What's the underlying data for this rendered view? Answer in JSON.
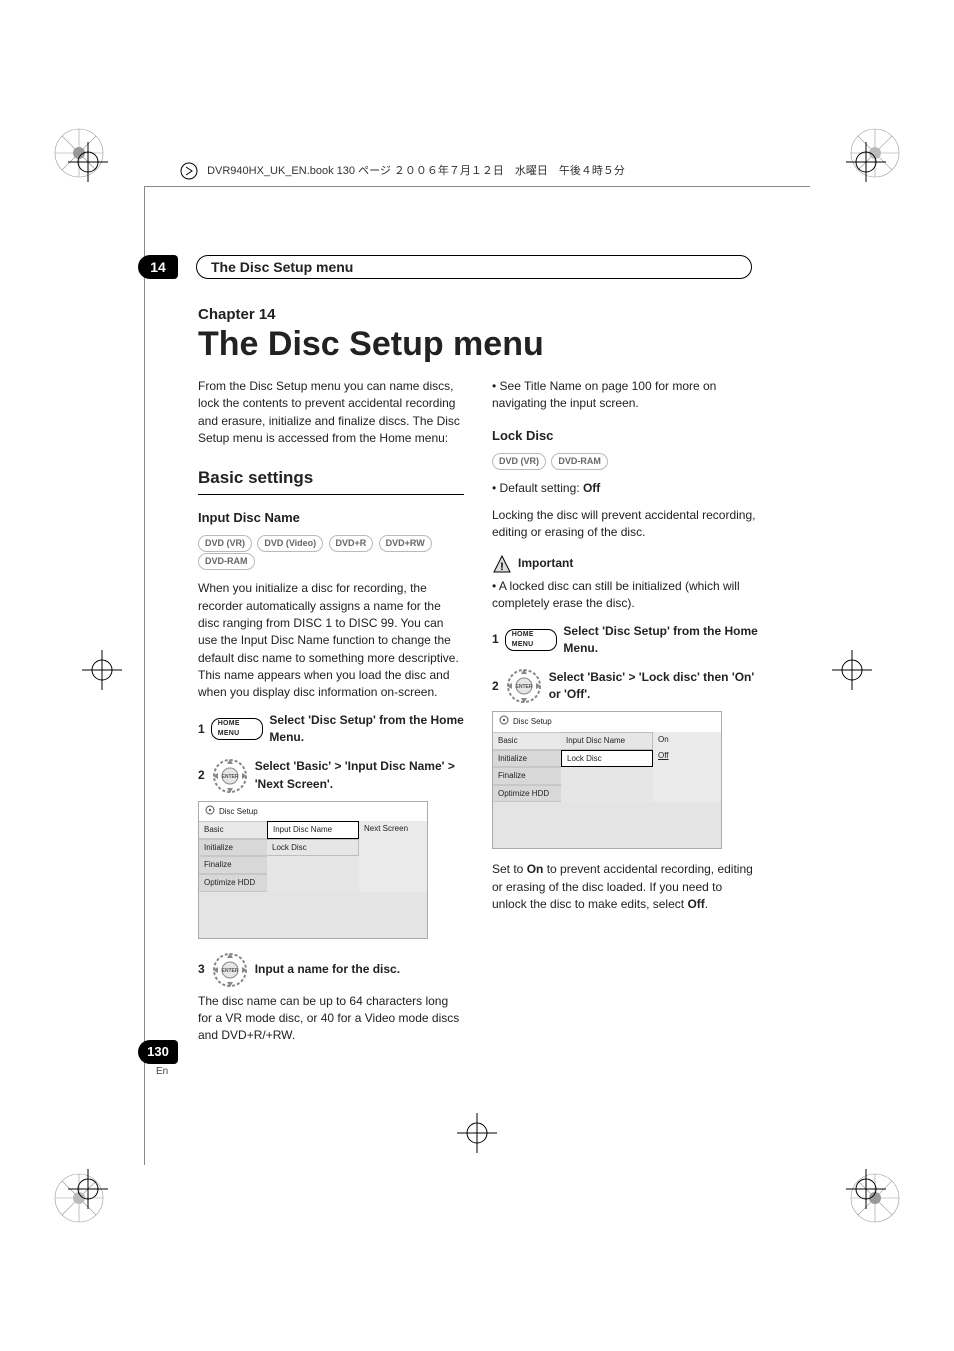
{
  "bookline": "DVR940HX_UK_EN.book  130 ページ  ２００６年７月１２日　水曜日　午後４時５分",
  "chapter_badge": "14",
  "header_title": "The Disc Setup menu",
  "chapter_label": "Chapter 14",
  "page_title": "The Disc Setup menu",
  "intro": "From the Disc Setup menu you can name discs, lock the contents to prevent accidental recording and erasure, initialize and finalize discs. The Disc Setup menu is accessed from the Home menu:",
  "h2_basic": "Basic settings",
  "input_disc_name": {
    "heading": "Input Disc Name",
    "formats": [
      "DVD (VR)",
      "DVD (Video)",
      "DVD+R",
      "DVD+RW",
      "DVD-RAM"
    ],
    "para": "When you initialize a disc for recording, the recorder automatically assigns a name for the disc ranging from DISC 1 to DISC 99. You can use the Input Disc Name function to change the default disc name to something more descriptive. This name appears when you load the disc and when you display disc information on-screen.",
    "step1_num": "1",
    "step1_pill": "HOME MENU",
    "step1_text": "Select 'Disc Setup' from the Home Menu.",
    "step2_num": "2",
    "step2_text": "Select 'Basic' > 'Input Disc Name' > 'Next Screen'.",
    "step3_num": "3",
    "step3_text": "Input a name for the disc.",
    "step3_para": "The disc name can be up to 64 characters long for a VR mode disc, or 40 for a Video mode discs and DVD+R/+RW."
  },
  "menu1": {
    "title": "Disc Setup",
    "sidebar": [
      "Basic",
      "Initialize",
      "Finalize",
      "Optimize HDD"
    ],
    "mid": [
      "Input Disc Name",
      "Lock Disc"
    ],
    "opt": "Next Screen"
  },
  "right": {
    "see_title_name": "See Title Name on page 100 for more on navigating the input screen.",
    "lock_heading": "Lock Disc",
    "lock_formats": [
      "DVD (VR)",
      "DVD-RAM"
    ],
    "default_setting_label": "Default setting:",
    "default_setting_value": "Off",
    "lock_para": "Locking the disc will prevent accidental recording, editing or erasing of the disc.",
    "important_label": "Important",
    "important_bullet": "A locked disc can still be initialized (which will completely erase the disc).",
    "step1_num": "1",
    "step1_pill": "HOME MENU",
    "step1_text": "Select 'Disc Setup' from the Home Menu.",
    "step2_num": "2",
    "step2_text": "Select 'Basic' > 'Lock disc' then 'On' or 'Off'.",
    "set_para_pre": "Set to ",
    "set_on": "On",
    "set_para_mid": " to prevent accidental recording, editing or erasing of the disc loaded. If you need to unlock the disc to make edits, select ",
    "set_off": "Off",
    "set_para_post": "."
  },
  "menu2": {
    "title": "Disc Setup",
    "sidebar": [
      "Basic",
      "Initialize",
      "Finalize",
      "Optimize HDD"
    ],
    "mid": [
      "Input Disc Name",
      "Lock Disc"
    ],
    "opts": [
      "On",
      "Off"
    ]
  },
  "page_number": "130",
  "page_lang": "En"
}
